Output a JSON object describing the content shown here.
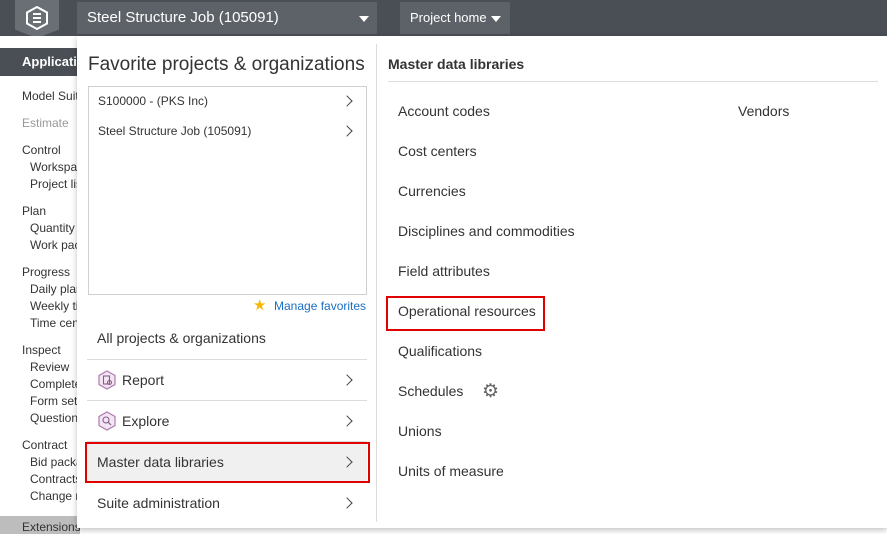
{
  "header": {
    "project": "Steel Structure Job (105091)",
    "home": "Project home"
  },
  "sidebar": {
    "applications": "Applications",
    "model_suite": "Model Suite",
    "estimate": "Estimate",
    "control": "Control",
    "workspaces": "Workspaces",
    "project_list": "Project list",
    "plan": "Plan",
    "quantity": "Quantity",
    "work_packages": "Work packages",
    "progress": "Progress",
    "daily_plan": "Daily plan",
    "weekly_time": "Weekly time",
    "time_center": "Time center",
    "inspect": "Inspect",
    "review": "Review",
    "complete": "Complete",
    "form_set": "Form setup",
    "questions": "Questions",
    "contract": "Contract",
    "bid_package": "Bid package",
    "contracts": "Contracts",
    "change": "Change requests",
    "extensions": "Extensions"
  },
  "favorites": {
    "title": "Favorite projects & organizations",
    "items": [
      "S100000 - (PKS Inc)",
      "Steel Structure Job (105091)"
    ],
    "manage": "Manage favorites"
  },
  "menu": {
    "all_projects": "All projects & organizations",
    "report": "Report",
    "explore": "Explore",
    "master_data": "Master data libraries",
    "suite_admin": "Suite administration"
  },
  "master_data": {
    "title": "Master data libraries",
    "items": [
      "Account codes",
      "Cost centers",
      "Currencies",
      "Disciplines and commodities",
      "Field attributes",
      "Operational resources",
      "Qualifications",
      "Schedules",
      "Unions",
      "Units of measure"
    ],
    "vendors": "Vendors"
  },
  "colors": {
    "topbar": "#4a4f55",
    "highlight": "#e00000",
    "link": "#1a6fc4",
    "star": "#f6b800"
  }
}
